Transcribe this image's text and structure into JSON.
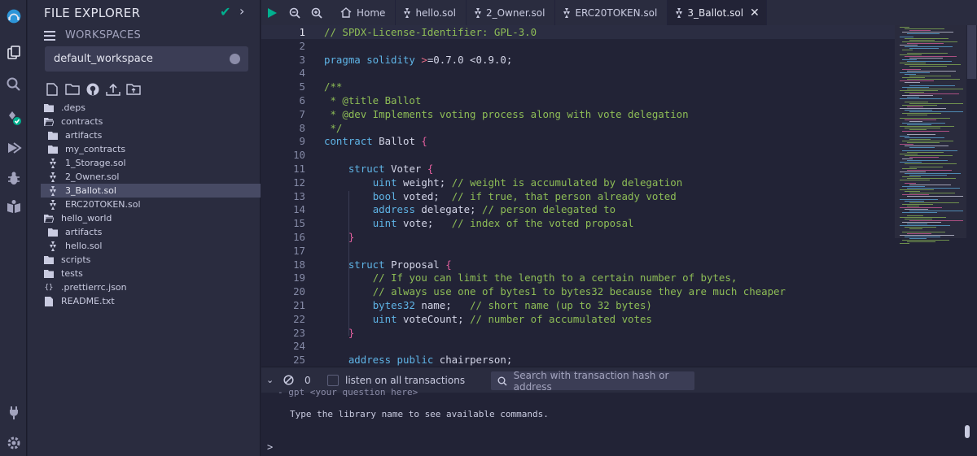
{
  "explorer": {
    "title": "FILE EXPLORER",
    "workspaces_label": "WORKSPACES",
    "workspace_selected": "default_workspace",
    "tree": [
      {
        "label": ".deps",
        "type": "folder",
        "indent": 0
      },
      {
        "label": "contracts",
        "type": "folder-open",
        "indent": 0
      },
      {
        "label": "artifacts",
        "type": "folder",
        "indent": 1
      },
      {
        "label": "my_contracts",
        "type": "folder",
        "indent": 1
      },
      {
        "label": "1_Storage.sol",
        "type": "sol",
        "indent": 1
      },
      {
        "label": "2_Owner.sol",
        "type": "sol",
        "indent": 1
      },
      {
        "label": "3_Ballot.sol",
        "type": "sol",
        "indent": 1,
        "selected": true
      },
      {
        "label": "ERC20TOKEN.sol",
        "type": "sol",
        "indent": 1
      },
      {
        "label": "hello_world",
        "type": "folder-open",
        "indent": 0
      },
      {
        "label": "artifacts",
        "type": "folder",
        "indent": 1
      },
      {
        "label": "hello.sol",
        "type": "sol",
        "indent": 1
      },
      {
        "label": "scripts",
        "type": "folder",
        "indent": 0
      },
      {
        "label": "tests",
        "type": "folder",
        "indent": 0
      },
      {
        "label": ".prettierrc.json",
        "type": "json",
        "indent": 0
      },
      {
        "label": "README.txt",
        "type": "file",
        "indent": 0
      }
    ]
  },
  "tabs": [
    {
      "label": "Home",
      "icon": "home-icon"
    },
    {
      "label": "hello.sol",
      "icon": "solidity-icon"
    },
    {
      "label": "2_Owner.sol",
      "icon": "solidity-icon"
    },
    {
      "label": "ERC20TOKEN.sol",
      "icon": "solidity-icon"
    },
    {
      "label": "3_Ballot.sol",
      "icon": "solidity-icon",
      "active": true
    }
  ],
  "editor": {
    "lines": [
      {
        "n": "1",
        "html": "<span class=\"cm\">// SPDX-License-Identifier: GPL-3.0</span>"
      },
      {
        "n": "2",
        "html": ""
      },
      {
        "n": "3",
        "html": "<span class=\"kw\">pragma solidity</span> <span class=\"op\">&gt;</span><span class=\"nm\">=0.7.0 &lt;0.9.0;</span>"
      },
      {
        "n": "4",
        "html": ""
      },
      {
        "n": "5",
        "html": "<span class=\"cm\">/**</span>"
      },
      {
        "n": "6",
        "html": "<span class=\"cm\"> * @title Ballot</span>"
      },
      {
        "n": "7",
        "html": "<span class=\"cm\"> * @dev Implements voting process along with vote delegation</span>"
      },
      {
        "n": "8",
        "html": "<span class=\"cm\"> */</span>"
      },
      {
        "n": "9",
        "html": "<span class=\"kw\">contract</span> <span class=\"nm\">Ballot</span> <span class=\"br\">{</span>"
      },
      {
        "n": "10",
        "html": ""
      },
      {
        "n": "11",
        "html": "    <span class=\"kw\">struct</span> <span class=\"nm\">Voter</span> <span class=\"br\">{</span>"
      },
      {
        "n": "12",
        "html": "        <span class=\"kw\">uint</span> <span class=\"nm\">weight;</span> <span class=\"cm\">// weight is accumulated by delegation</span>"
      },
      {
        "n": "13",
        "html": "        <span class=\"kw\">bool</span> <span class=\"nm\">voted;</span>  <span class=\"cm\">// if true, that person already voted</span>"
      },
      {
        "n": "14",
        "html": "        <span class=\"kw\">address</span> <span class=\"nm\">delegate;</span> <span class=\"cm\">// person delegated to</span>"
      },
      {
        "n": "15",
        "html": "        <span class=\"kw\">uint</span> <span class=\"nm\">vote;</span>   <span class=\"cm\">// index of the voted proposal</span>"
      },
      {
        "n": "16",
        "html": "    <span class=\"br\">}</span>"
      },
      {
        "n": "17",
        "html": ""
      },
      {
        "n": "18",
        "html": "    <span class=\"kw\">struct</span> <span class=\"nm\">Proposal</span> <span class=\"br\">{</span>"
      },
      {
        "n": "19",
        "html": "        <span class=\"cm\">// If you can limit the length to a certain number of bytes,</span>"
      },
      {
        "n": "20",
        "html": "        <span class=\"cm\">// always use one of bytes1 to bytes32 because they are much cheaper</span>"
      },
      {
        "n": "21",
        "html": "        <span class=\"kw\">bytes32</span> <span class=\"nm\">name;</span>   <span class=\"cm\">// short name (up to 32 bytes)</span>"
      },
      {
        "n": "22",
        "html": "        <span class=\"kw\">uint</span> <span class=\"nm\">voteCount;</span> <span class=\"cm\">// number of accumulated votes</span>"
      },
      {
        "n": "23",
        "html": "    <span class=\"br\">}</span>"
      },
      {
        "n": "24",
        "html": ""
      },
      {
        "n": "25",
        "html": "    <span class=\"kw\">address</span> <span class=\"kw\">public</span> <span class=\"nm\">chairperson;</span>"
      }
    ]
  },
  "terminal": {
    "tx_count": "0",
    "listen_label": "listen on all transactions",
    "search_placeholder": "Search with transaction hash or address",
    "cut_line": "- gpt <your question here>",
    "message": "Type the library name to see available commands.",
    "prompt": ">"
  }
}
